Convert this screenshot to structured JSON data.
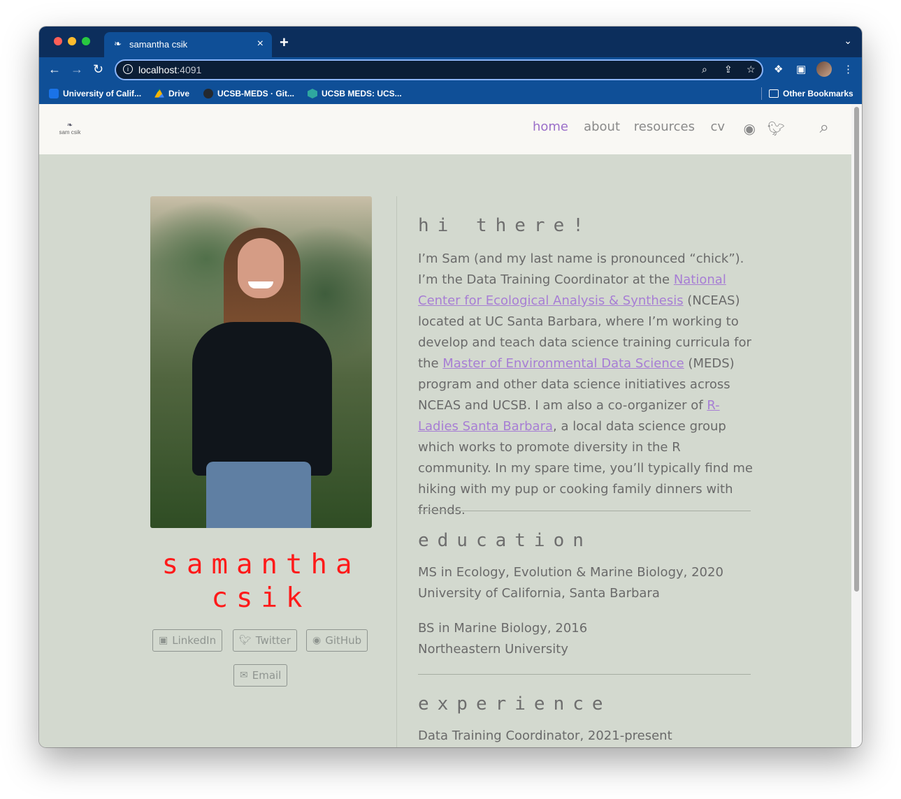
{
  "browser": {
    "tab_title": "samantha csik",
    "tab_close": "×",
    "new_tab": "+",
    "url_host": "localhost",
    "url_port": ":4091",
    "bookmarks": [
      {
        "label": "University of Calif...",
        "color": "#1a73e8"
      },
      {
        "label": "Drive",
        "color": "#f4b400"
      },
      {
        "label": "UCSB-MEDS · Git...",
        "color": "#24292f"
      },
      {
        "label": "UCSB MEDS: UCS...",
        "color": "#2fa79f"
      }
    ],
    "other_bookmarks": "Other Bookmarks"
  },
  "site": {
    "logo_text": "sam csik",
    "nav": {
      "home": "home",
      "about": "about",
      "resources": "resources",
      "cv": "cv"
    },
    "accent_color": "#9b6fc9"
  },
  "profile": {
    "name_line1": "samantha",
    "name_line2": "csik",
    "name_color": "#ff1a1a",
    "buttons": {
      "linkedin": "LinkedIn",
      "twitter": "Twitter",
      "github": "GitHub",
      "email": "Email"
    }
  },
  "intro": {
    "heading": "hi there!",
    "p1": "I’m Sam (and my last name is pronounced “chick”). I’m the Data Training Coordinator at the ",
    "link_nceas": "National Center for Ecological Analysis & Synthesis",
    "p2": " (NCEAS) located at UC Santa Barbara, where I’m working to develop and teach data science training curricula for the ",
    "link_meds": "Master of Environmental Data Science",
    "p3": " (MEDS) program and other data science initiatives across NCEAS and UCSB. I am also a co-organizer of ",
    "link_rladies": "R-Ladies Santa Barbara",
    "p4": ", a local data science group which works to promote diversity in the R community. In my spare time, you’ll typically find me hiking with my pup or cooking family dinners with friends."
  },
  "education": {
    "heading": "education",
    "items": [
      {
        "degree": "MS in Ecology, Evolution & Marine Biology, 2020",
        "school": "University of California, Santa Barbara"
      },
      {
        "degree": "BS in Marine Biology, 2016",
        "school": "Northeastern University"
      }
    ]
  },
  "experience": {
    "heading": "experience",
    "items": [
      {
        "role": "Data Training Coordinator, 2021-present"
      }
    ]
  }
}
